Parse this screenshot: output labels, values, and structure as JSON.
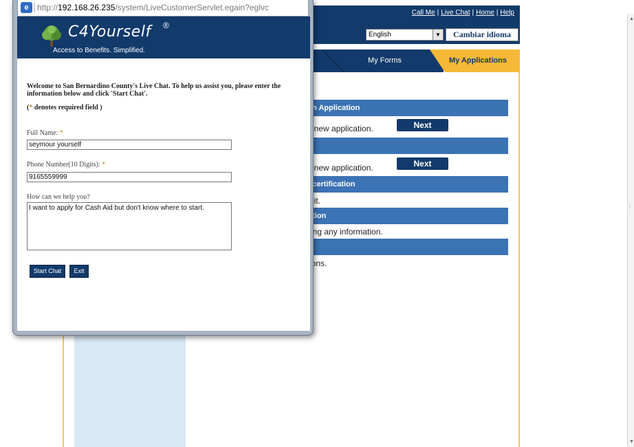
{
  "background": {
    "top_links": [
      "Call Me",
      "Live Chat",
      "Home",
      "Help"
    ],
    "language": {
      "selected": "English",
      "button": "Cambiar idioma"
    },
    "tabs": {
      "forms": "My Forms",
      "applications": "My Applications"
    },
    "sections": [
      {
        "title": "sh Application",
        "text": "t a new application.",
        "button": "Next"
      },
      {
        "title": "",
        "text": "t a new application.",
        "button": "Next"
      },
      {
        "title": "ecertification",
        "text": "bmit."
      },
      {
        "title": "ation",
        "text": "ssing any information."
      },
      {
        "title": "",
        "text": "ations."
      }
    ]
  },
  "popup": {
    "address": {
      "prefix": "http://",
      "host": "192.168.26.235",
      "path": "/system/LiveCustomerServlet.egain?eglvc"
    },
    "brand": {
      "name": "C4Yourself",
      "registered": "®",
      "tagline": "Access to Benefits.  Simplified."
    },
    "form": {
      "welcome": "Welcome to San Bernardino County's Live Chat. To help us assist you, please enter the information below and click 'Start Chat'.",
      "required_note_before": "(",
      "required_note_star": "*",
      "required_note_after": " denotes required field )",
      "full_name_label": "Full Name: ",
      "full_name_value": "seymour yourself",
      "phone_label": "Phone Number(10 Digits): ",
      "phone_value": "9165559999",
      "help_label": "How can we help you?",
      "help_value": "I want to apply for Cash Aid but don't know where to start.",
      "required_star": "*",
      "start_button": "Start Chat",
      "exit_button": "Exit"
    }
  }
}
